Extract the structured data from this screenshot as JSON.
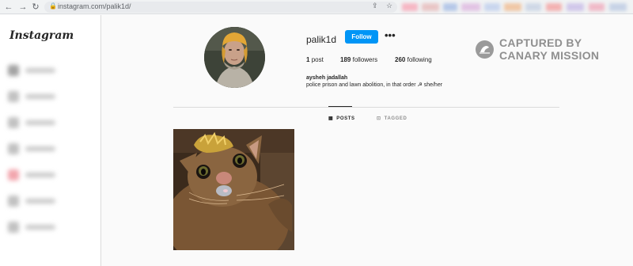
{
  "browser": {
    "url": "instagram.com/palik1d/",
    "back_icon": "arrow-left-icon",
    "forward_icon": "arrow-right-icon",
    "reload_icon": "reload-icon",
    "back_glyph": "←",
    "forward_glyph": "→",
    "reload_glyph": "↻",
    "lock_glyph": "🔒",
    "share_glyph": "⇪",
    "star_glyph": "☆"
  },
  "sidebar": {
    "logo": "Instagram"
  },
  "profile": {
    "username": "palik1d",
    "follow_label": "Follow",
    "more_label": "•••",
    "stats": {
      "posts_count": "1",
      "posts_label": "post",
      "followers_count": "189",
      "followers_label": "followers",
      "following_count": "260",
      "following_label": "following"
    },
    "full_name": "aysheh jadallah",
    "bio": "police prison and lawn abolition, in that order ☭ she/her"
  },
  "watermark": {
    "line1": "CAPTURED BY",
    "line2": "CANARY MISSION"
  },
  "tabs": [
    {
      "label": "POSTS",
      "icon": "grid-icon",
      "glyph": "▦",
      "active": true
    },
    {
      "label": "TAGGED",
      "icon": "tag-icon",
      "glyph": "⊡",
      "active": false
    }
  ],
  "colors": {
    "follow_button": "#0095f6",
    "background": "#fafafa",
    "watermark": "#8f8f8f"
  }
}
